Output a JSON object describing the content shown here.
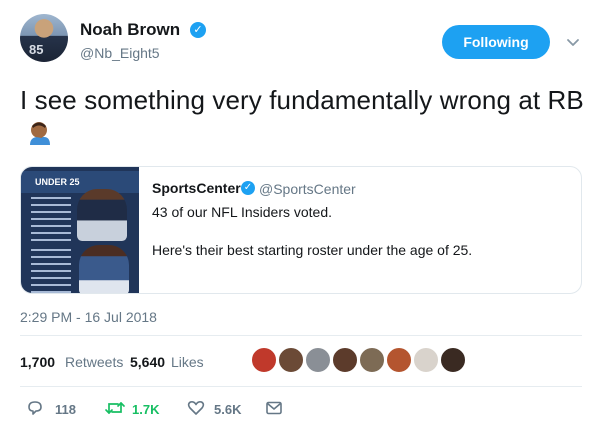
{
  "tweet": {
    "author": {
      "display_name": "Noah Brown",
      "handle": "@Nb_Eight5",
      "avatar_jersey": "85"
    },
    "follow_button_label": "Following",
    "text": "I see something very fundamentally wrong at RB",
    "emoji_icon": "facepalm-icon",
    "quoted": {
      "display_name": "SportsCenter",
      "handle": "@SportsCenter",
      "line1": "43 of our NFL Insiders voted.",
      "line2": "Here's their best starting roster under the age of 25.",
      "media_title": "UNDER 25"
    },
    "timestamp": "2:29 PM - 16 Jul 2018",
    "stats": {
      "retweets_count": "1,700",
      "retweets_label": "Retweets",
      "likes_count": "5,640",
      "likes_label": "Likes"
    },
    "actions": {
      "reply_count": "118",
      "retweet_count": "1.7K",
      "like_count": "5.6K"
    }
  },
  "colors": {
    "accent": "#1da1f2",
    "retweet_green": "#17bf63",
    "muted": "#657786",
    "text": "#14171a"
  }
}
